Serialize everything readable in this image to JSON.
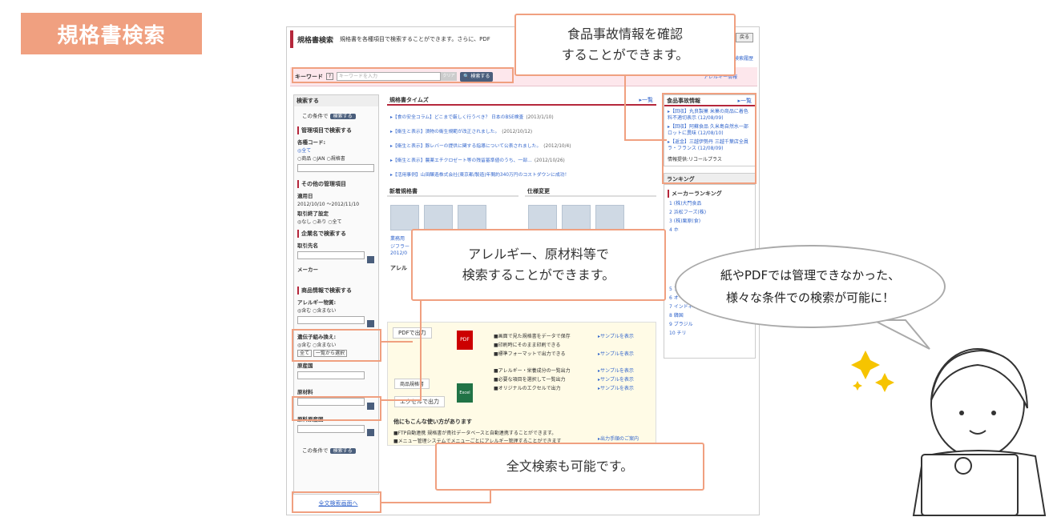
{
  "badge": "規格書検索",
  "screenshot": {
    "title": "規格書検索",
    "subtitle": "規格書を各種項目で検索することができます。さらに、PDF",
    "back": "戻る",
    "history": "検索履歴",
    "keyword_label": "キーワード",
    "keyword_placeholder": "キーワードを入力",
    "clear": "クリア",
    "search_btn": "検索する",
    "allergen_info": "アレルギー情報",
    "side": {
      "heading": "検索する",
      "cond_label": "この条件で",
      "manage_title": "管理項目で検索する",
      "code_label": "各種コード:",
      "code_all": "◎全て",
      "code_opts": "○商品 ○JAN ○規格書",
      "other_title": "その他の管理項目",
      "apply_label": "適用日",
      "apply_from": "2012/10/10",
      "apply_to": "2012/11/10",
      "end_label": "取引終了設定",
      "end_opts": "◎なし ○あり ○全て",
      "company_title": "企業名で検索する",
      "partner_label": "取引先名",
      "maker_label": "メーカー",
      "product_title": "商品情報で検索する",
      "allergy_label": "アレルギー物質:",
      "allergy_opts": "◎含む ○含まない",
      "gmo_label": "遺伝子組み換え:",
      "gmo_opts": "◎含む ○含まない",
      "all": "全て",
      "list_select": "一覧から選択",
      "origin_label": "原産国",
      "material_label": "原材料",
      "material_origin_label": "原料原産国",
      "fulltext": "全文検索画面へ"
    },
    "times": {
      "title": "規格書タイムズ",
      "more": "▸一覧",
      "items": [
        {
          "t": "▸【食の安全コラム】どこまで厳しく行うべき？ 日本のBSE検査",
          "d": "(2013/1/10)"
        },
        {
          "t": "▸【衛生と表示】漬物の衛生規範が改正されました。",
          "d": "(2012/10/12)"
        },
        {
          "t": "▸【衛生と表示】豚レバーの提供に関する指導について公表されました。",
          "d": "(2012/10/4)"
        },
        {
          "t": "▸【衛生と表示】農薬エチクロゼート等の残留基準値のうち、一部…",
          "d": "(2012/10/26)"
        },
        {
          "t": "▸【活用事例】山田醸造株式会社(東京都/製造)年間約340万円のコストダウンに成功！",
          "d": ""
        }
      ]
    },
    "new_specs": "新着規格書",
    "spec_change": "仕様変更",
    "product_name": "業務用",
    "product_name2": "ジフラー",
    "product_date": "2012/0",
    "allergy_tab": "アレル",
    "pdf_output": "PDFで出力",
    "pdf": "PDF",
    "excel": "Excel",
    "spec_doc": "商品規格書",
    "excel_output": "エクセルで出力",
    "features": [
      "■画面で見た規格書をデータで保存",
      "■印刷時にそのまま印刷できる",
      "■標準フォーマットで出力できる",
      "■アレルギー・栄養成分の一覧出力",
      "■必要な項目を選択して一覧出力",
      "■オリジナルのエクセルで出力"
    ],
    "sample": "▸サンプルを表示",
    "procedure": "▸出力手順のご案内",
    "other_uses": "他にもこんな使い方があります",
    "use1": "■FTP自動連携  規格書が貴社データベースと自動連携することができます。",
    "use2": "■メニュー管理システムでメニューごとにアレルギー管理することができます",
    "food_accidents": {
      "title": "食品事故情報",
      "more": "▸一覧",
      "items": [
        "▸【回収】丸良製菓 米菓の商品に着色料不適切表示 (12/08/09)",
        "▸【回収】阿蘇食品 久米島自然水一部ロットに異味 (12/08/10)",
        "▸【返金】三越伊勢丹 三越千葉店全員ラ・フランス (12/08/09)"
      ],
      "provider": "情報提供:リコールプラス"
    },
    "ranking": {
      "title": "ランキング",
      "maker": "メーカーランキング",
      "items": [
        "1 (株)大門食品",
        "2 浜松フーズ(株)",
        "3 (株)栗原(食)",
        "4 ホ"
      ],
      "countries": [
        "5 アメリカ",
        "6 オーストラリア",
        "7 インドネシア",
        "8 韓国",
        "9 ブラジル",
        "10 チリ"
      ]
    }
  },
  "callouts": {
    "food_accident": "食品事故情報を確認\nすることができます。",
    "allergy": "アレルギー、原材料等で\n検索することができます。",
    "fulltext": "全文検索も可能です。",
    "bubble": "紙やPDFでは管理できなかった、\n様々な条件での検索が可能に！"
  },
  "colors": {
    "accent": "#f0a080",
    "brand": "#b5273b"
  }
}
